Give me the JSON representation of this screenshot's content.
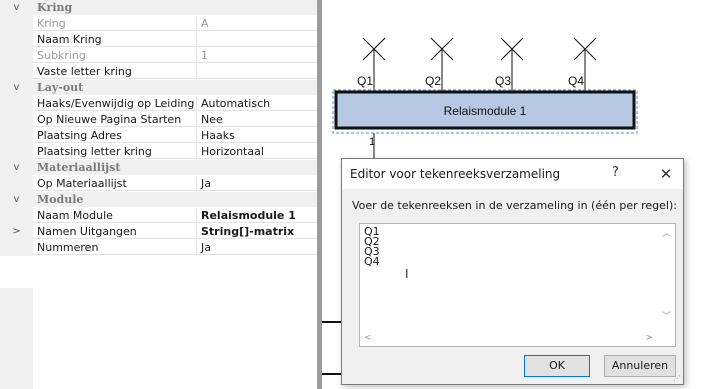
{
  "property_grid": {
    "rows": [
      {
        "type": "category",
        "gutter": "v",
        "name": "Kring"
      },
      {
        "type": "prop",
        "name": "Kring",
        "value": "A",
        "dim": true
      },
      {
        "type": "prop",
        "name": "Naam Kring",
        "value": ""
      },
      {
        "type": "prop",
        "name": "Subkring",
        "value": "1",
        "dim": true
      },
      {
        "type": "prop",
        "name": "Vaste letter kring",
        "value": ""
      },
      {
        "type": "category",
        "gutter": "v",
        "name": "Lay-out"
      },
      {
        "type": "prop",
        "name": "Haaks/Evenwijdig op Leiding",
        "value": "Automatisch"
      },
      {
        "type": "prop",
        "name": "Op Nieuwe Pagina Starten",
        "value": "Nee"
      },
      {
        "type": "prop",
        "name": "Plaatsing Adres",
        "value": "Haaks"
      },
      {
        "type": "prop",
        "name": "Plaatsing letter kring",
        "value": "Horizontaal"
      },
      {
        "type": "category",
        "gutter": "v",
        "name": "Materiaallijst"
      },
      {
        "type": "prop",
        "name": "Op Materiaallijst",
        "value": "Ja"
      },
      {
        "type": "category",
        "gutter": "v",
        "name": "Module"
      },
      {
        "type": "prop",
        "name": "Naam Module",
        "value": "Relaismodule 1",
        "bold": true
      },
      {
        "type": "prop",
        "gutter": ">",
        "name": "Namen Uitgangen",
        "value": "String[]-matrix",
        "bold": true
      },
      {
        "type": "prop",
        "name": "Nummeren",
        "value": "Ja"
      }
    ]
  },
  "canvas": {
    "outputs": [
      "Q1",
      "Q2",
      "Q3",
      "Q4"
    ],
    "module_label": "Relaismodule 1",
    "connector_number": "1"
  },
  "dialog": {
    "title": "Editor voor tekenreeksverzameling",
    "help_label": "?",
    "close_label": "✕",
    "prompt": "Voer de tekenreeksen in de verzameling in (één per regel):",
    "lines": [
      "Q1",
      "Q2",
      "Q3",
      "Q4"
    ],
    "ok_label": "OK",
    "cancel_label": "Annuleren"
  }
}
